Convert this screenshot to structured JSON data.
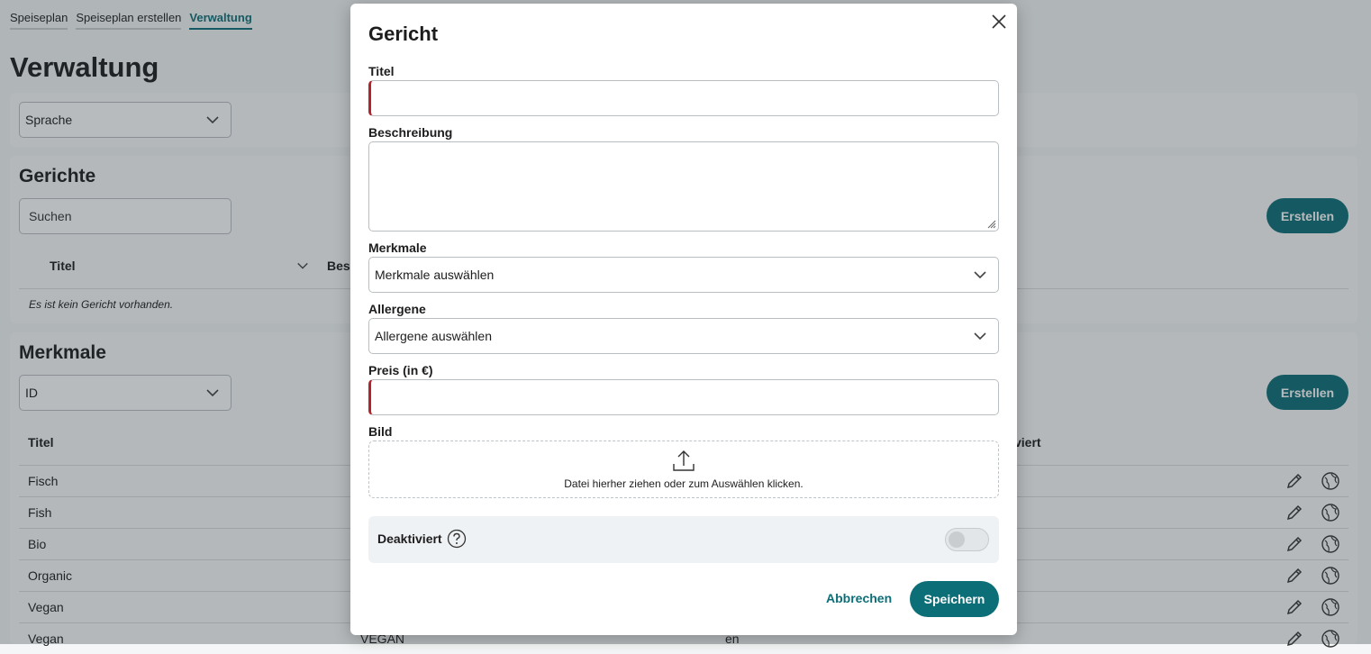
{
  "nav": {
    "tabs": [
      "Speiseplan",
      "Speiseplan erstellen",
      "Verwaltung"
    ],
    "active": "Verwaltung"
  },
  "page": {
    "title": "Verwaltung"
  },
  "language_select": {
    "value": "Sprache"
  },
  "dishes": {
    "title": "Gerichte",
    "search_placeholder": "Suchen",
    "create_label": "Erstellen",
    "columns": [
      "Titel",
      "Bes"
    ],
    "empty_text": "Es ist kein Gericht vorhanden."
  },
  "features": {
    "title": "Merkmale",
    "sort_value": "ID",
    "create_label": "Erstellen",
    "columns": [
      "Titel",
      "viert"
    ],
    "rows": [
      {
        "title": "Fisch"
      },
      {
        "title": "Fish"
      },
      {
        "title": "Bio"
      },
      {
        "title": "Organic"
      },
      {
        "title": "Vegan"
      },
      {
        "title": "Vegan",
        "code": "VEGAN",
        "lang": "en"
      }
    ]
  },
  "modal": {
    "title": "Gericht",
    "fields": {
      "title_label": "Titel",
      "description_label": "Beschreibung",
      "features_label": "Merkmale",
      "features_placeholder": "Merkmale auswählen",
      "allergens_label": "Allergene",
      "allergens_placeholder": "Allergene auswählen",
      "price_label": "Preis (in €)",
      "image_label": "Bild",
      "image_drop_text": "Datei hierher ziehen oder zum Auswählen klicken."
    },
    "deactivated_label": "Deaktiviert",
    "deactivated_value": false,
    "cancel_label": "Abbrechen",
    "save_label": "Speichern"
  },
  "colors": {
    "accent": "#0c6f78",
    "required": "#b3232b",
    "overlay": "rgba(40,48,56,0.33)"
  }
}
